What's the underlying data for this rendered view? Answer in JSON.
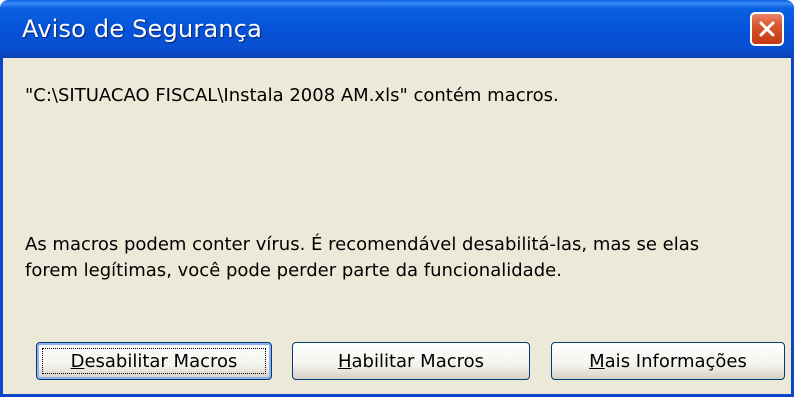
{
  "window": {
    "title": "Aviso de Segurança",
    "close_icon": "close-icon"
  },
  "message": {
    "file_line": "\"C:\\SITUACAO FISCAL\\Instala 2008 AM.xls\" contém macros.",
    "warning_line1": "As macros podem conter vírus. É recomendável desabilitá-las, mas se elas",
    "warning_line2": "forem legítimas, você pode perder parte da funcionalidade."
  },
  "buttons": {
    "disable": {
      "pre": "",
      "accel": "D",
      "post": "esabilitar Macros"
    },
    "enable": {
      "pre": "",
      "accel": "H",
      "post": "abilitar Macros"
    },
    "info": {
      "pre": "",
      "accel": "M",
      "post": "ais Informações"
    }
  },
  "colors": {
    "titlebar": "#0553d9",
    "dialog_bg": "#ece9d8",
    "close_button": "#d9542c"
  }
}
